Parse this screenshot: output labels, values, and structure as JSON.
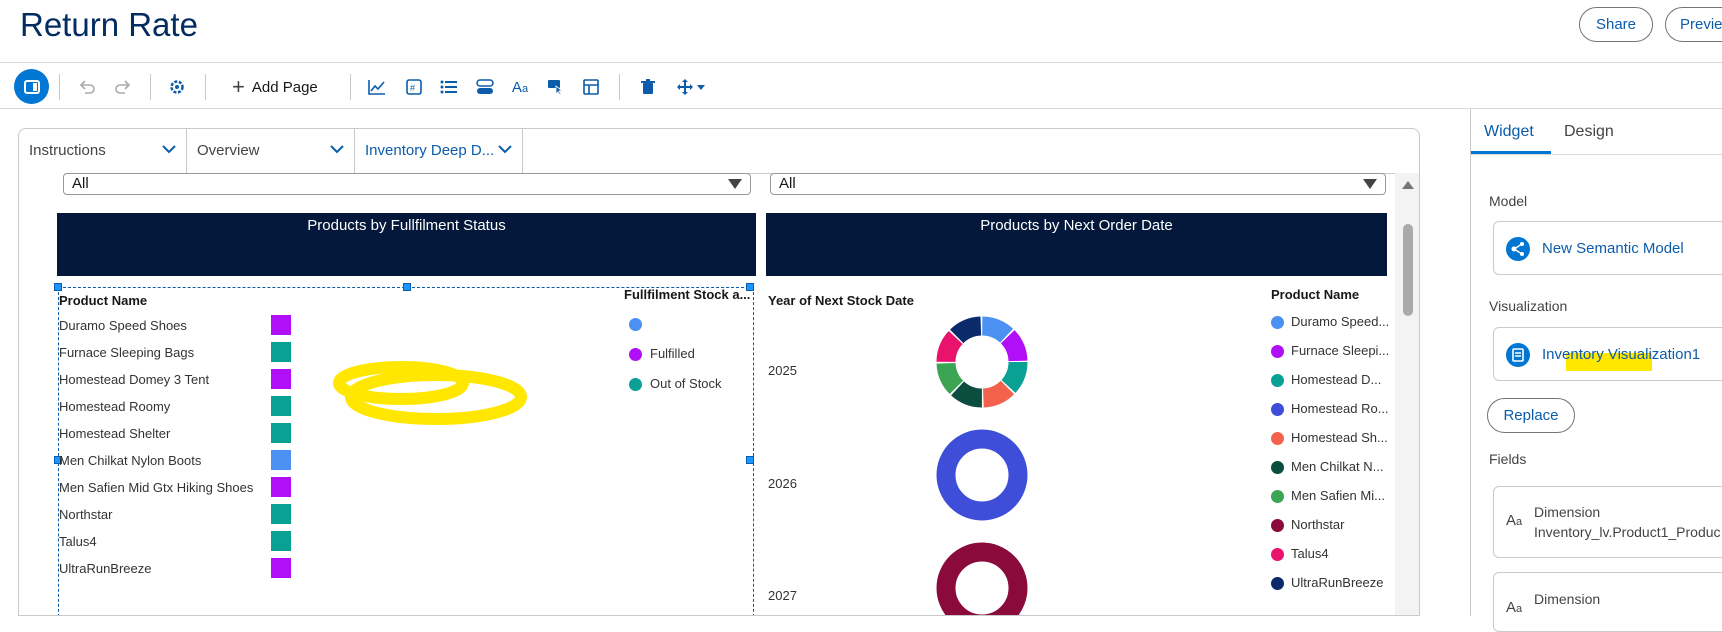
{
  "header": {
    "title": "Return Rate",
    "share_label": "Share",
    "preview_label": "Previe"
  },
  "toolbar": {
    "add_page_label": "Add Page"
  },
  "tabs": [
    {
      "label": "Instructions"
    },
    {
      "label": "Overview"
    },
    {
      "label": "Inventory Deep D..."
    }
  ],
  "filters": {
    "left_value": "All",
    "right_value": "All"
  },
  "widget_left": {
    "title": "Products by Fullfilment Status",
    "col_header": "Product Name",
    "legend_title": "Fullfilment Stock a...",
    "products": [
      {
        "name": "Duramo Speed Shoes",
        "status_color": "#b10ff7"
      },
      {
        "name": "Furnace Sleeping Bags",
        "status_color": "#0aa094"
      },
      {
        "name": "Homestead Domey 3 Tent",
        "status_color": "#b10ff7"
      },
      {
        "name": "Homestead Roomy",
        "status_color": "#0aa094"
      },
      {
        "name": "Homestead Shelter",
        "status_color": "#0aa094"
      },
      {
        "name": "Men Chilkat Nylon Boots",
        "status_color": "#4b91f2"
      },
      {
        "name": "Men Safien Mid Gtx Hiking Shoes",
        "status_color": "#b10ff7"
      },
      {
        "name": "Northstar",
        "status_color": "#0aa094"
      },
      {
        "name": "Talus4",
        "status_color": "#0aa094"
      },
      {
        "name": "UltraRunBreeze",
        "status_color": "#b10ff7"
      }
    ],
    "legend": [
      {
        "label": "",
        "color": "#4b91f2"
      },
      {
        "label": "Fulfilled",
        "color": "#b10ff7"
      },
      {
        "label": "Out of Stock",
        "color": "#0aa094"
      }
    ]
  },
  "widget_right": {
    "title": "Products by Next Order Date",
    "row_header": "Year of Next Stock Date",
    "legend_title": "Product Name",
    "years": [
      "2025",
      "2026",
      "2027"
    ],
    "legend": [
      {
        "label": "Duramo Speed...",
        "color": "#4b91f2"
      },
      {
        "label": "Furnace Sleepi...",
        "color": "#b10ff7"
      },
      {
        "label": "Homestead D...",
        "color": "#0aa094"
      },
      {
        "label": "Homestead Ro...",
        "color": "#3e4ed8"
      },
      {
        "label": "Homestead Sh...",
        "color": "#f2624d"
      },
      {
        "label": "Men Chilkat N...",
        "color": "#0b4e3f"
      },
      {
        "label": "Men Safien Mi...",
        "color": "#3ba553"
      },
      {
        "label": "Northstar",
        "color": "#8a0b3b"
      },
      {
        "label": "Talus4",
        "color": "#e9136e"
      },
      {
        "label": "UltraRunBreeze",
        "color": "#0a2a6b"
      }
    ]
  },
  "right_panel": {
    "tab_widget": "Widget",
    "tab_design": "Design",
    "model_label": "Model",
    "model_value": "New Semantic Model",
    "viz_label": "Visualization",
    "viz_value": "Inventory Visualization1",
    "replace_label": "Replace",
    "fields_label": "Fields",
    "field1_type": "Dimension",
    "field1_name": "Inventory_lv.Product1_Produc",
    "field2_type": "Dimension"
  },
  "colors": {
    "accent": "#0176d3",
    "navy": "#03183a",
    "highlight": "#ffe700"
  }
}
